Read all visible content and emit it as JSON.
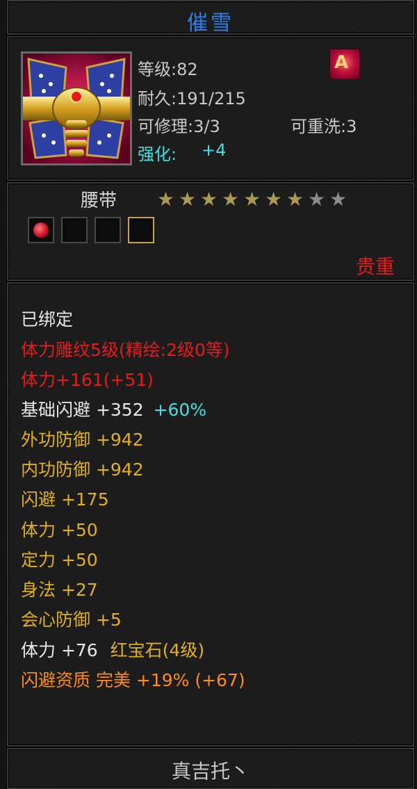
{
  "item": {
    "name": "催雪",
    "type": "腰带",
    "rarity": "贵重",
    "grade_badge": "A",
    "stars_total": 9,
    "stars_lit": 7,
    "gem_slots": [
      {
        "filled": true,
        "gem": "red-gem-icon",
        "gold": false
      },
      {
        "filled": false,
        "gold": false
      },
      {
        "filled": false,
        "gold": false
      },
      {
        "filled": false,
        "gold": true
      }
    ]
  },
  "stats": {
    "level": "等级:82",
    "durability": "耐久:191/215",
    "repair": "可修理:3/3",
    "rewash": "可重洗:3",
    "enhance_label": "强化:",
    "enhance_value": "+4"
  },
  "attributes": {
    "bound": "已绑定",
    "engrave": "体力雕纹5级(精绘:2级0等)",
    "stamina_total": "体力+161(+51)",
    "base_dodge": "基础闪避 +352",
    "base_dodge_bonus": "+60%",
    "ext_def": "外功防御 +942",
    "int_def": "内功防御 +942",
    "dodge": "闪避 +175",
    "stamina": "体力 +50",
    "focus": "定力 +50",
    "agility": "身法 +27",
    "crit_def": "会心防御 +5",
    "gem_stat": "体力 +76",
    "gem_name": "红宝石(4级)",
    "quality": "闪避资质  完美 +19% (+67)"
  },
  "owner": "真吉托丶",
  "colors": {
    "title": "#2f7fe6",
    "enhance": "#3fe0e0",
    "red": "#e41c1c",
    "gold": "#e0b020",
    "orange": "#ff8c1a",
    "white": "#e8e8e8",
    "cyan": "#3fe0e0"
  }
}
